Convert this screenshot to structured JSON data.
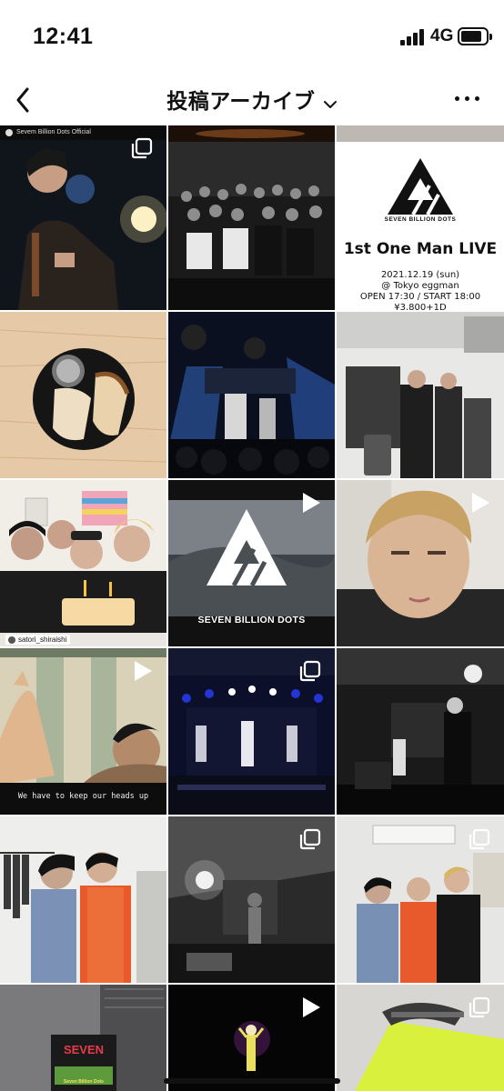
{
  "status_bar": {
    "time": "12:41",
    "network": "4G",
    "signal_icon": "signal-bars-icon",
    "battery_icon": "battery-icon"
  },
  "header": {
    "title": "投稿アーカイブ",
    "back_icon": "chevron-left-icon",
    "dropdown_icon": "chevron-down-icon",
    "more_icon": "more-horizontal-icon"
  },
  "posts": [
    {
      "caption": "Sevem Billion Dots Official",
      "badge": "multi-photo-icon"
    },
    {
      "badge": ""
    },
    {
      "brand": "SEVEN BILLION DOTS",
      "title": "1st One Man LIVE",
      "lines": [
        "2021.12.19 (sun)",
        "@ Tokyo eggman",
        "OPEN 17:30 / START 18:00",
        "¥3,800+1D"
      ]
    },
    {
      "badge": ""
    },
    {
      "badge": ""
    },
    {
      "badge": ""
    },
    {
      "user_tag": "satori_shiraishi"
    },
    {
      "logo_text": "SEVEN BILLION DOTS",
      "badge": "play-icon"
    },
    {
      "badge": "play-icon"
    },
    {
      "subtitle": "We have to keep our heads up",
      "badge": "play-icon"
    },
    {
      "badge": "multi-photo-icon"
    },
    {
      "badge": ""
    },
    {
      "badge": ""
    },
    {
      "badge": "multi-photo-icon"
    },
    {
      "badge": "multi-photo-icon"
    },
    {
      "sign_top": "SEVEN",
      "sign_bottom": "Seven Billion Dots"
    },
    {
      "badge": "play-icon"
    },
    {
      "badge": "multi-photo-icon"
    }
  ]
}
